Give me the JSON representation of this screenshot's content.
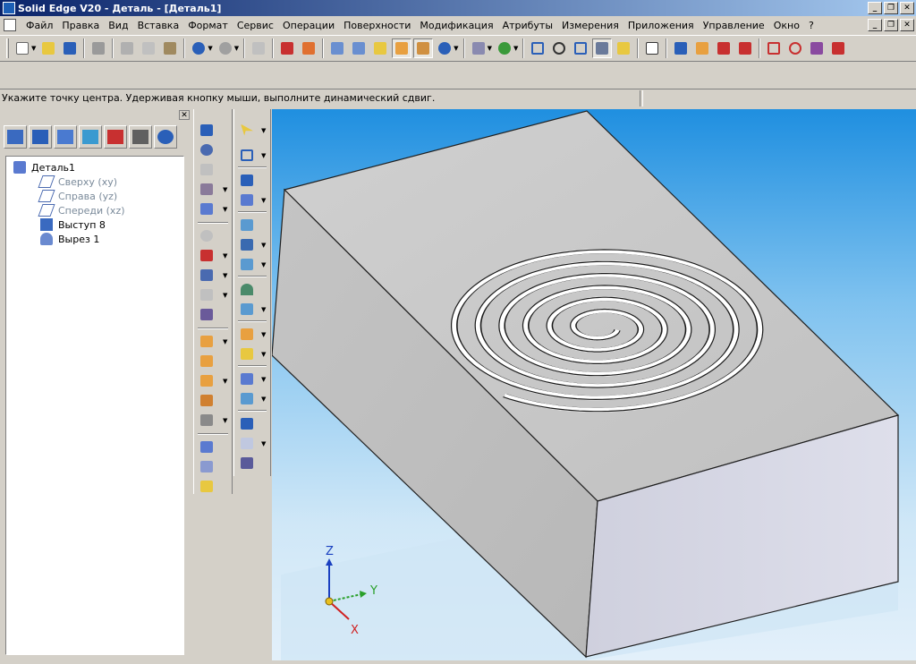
{
  "window": {
    "title": "Solid Edge V20 - Деталь - [Деталь1]",
    "buttons": [
      "_",
      "❐",
      "✕"
    ]
  },
  "menu": {
    "items": [
      "Файл",
      "Правка",
      "Вид",
      "Вставка",
      "Формат",
      "Сервис",
      "Операции",
      "Поверхности",
      "Модификация",
      "Атрибуты",
      "Измерения",
      "Приложения",
      "Управление",
      "Окно",
      "?"
    ]
  },
  "prompt": {
    "text": "Укажите точку центра. Удерживая кнопку мыши, выполните  динамический сдвиг."
  },
  "toolbar": {
    "icons": [
      "new-icon",
      "open-icon",
      "save-icon",
      "print-icon",
      "cut-icon",
      "copy-icon",
      "paste-icon",
      "undo-icon",
      "redo-icon",
      "insert-icon",
      "properties-icon",
      "view-iso-icon",
      "view-front-icon",
      "shaded-icon",
      "shaded-edges-icon",
      "shaded-visible-icon",
      "globe-icon",
      "display-icon",
      "rotate-icon",
      "zoom-area-icon",
      "zoom-icon",
      "fit-icon",
      "pan-icon",
      "help-icon",
      "text-icon",
      "part-icon",
      "feature-icon",
      "delete-feature-icon",
      "flip-icon",
      "box-icon",
      "sketch-icon",
      "edit-icon",
      "check-icon"
    ],
    "colors": {
      "blue": "#2a5fb8",
      "yellow": "#e8c840",
      "red": "#c83030",
      "green": "#3a9a3a"
    }
  },
  "pathfinder": {
    "tabs": [
      "features-tab-icon",
      "layers-tab-icon",
      "assembly-tab-icon",
      "library-tab-icon",
      "family-tab-icon",
      "sensor-tab-icon",
      "settings-tab-icon"
    ],
    "tree": {
      "root": "Деталь1",
      "items": [
        {
          "label": "Сверху (xy)",
          "icon": "plane-icon",
          "dim": true
        },
        {
          "label": "Справа (yz)",
          "icon": "plane-icon",
          "dim": true
        },
        {
          "label": "Спереди (xz)",
          "icon": "plane-icon",
          "dim": true
        },
        {
          "label": "Выступ 8",
          "icon": "protrusion-icon",
          "dim": false
        },
        {
          "label": "Вырез 1",
          "icon": "cutout-icon",
          "dim": false
        }
      ]
    }
  },
  "viewport": {
    "axes": {
      "x": "X",
      "y": "Y",
      "z": "Z"
    },
    "colors": {
      "background_top": "#1f8fe0",
      "background_bottom": "#e3f0fa",
      "part_top": "#c6c6c6",
      "part_left": "#bcbcbc",
      "part_right": "#d8d8e6"
    }
  }
}
